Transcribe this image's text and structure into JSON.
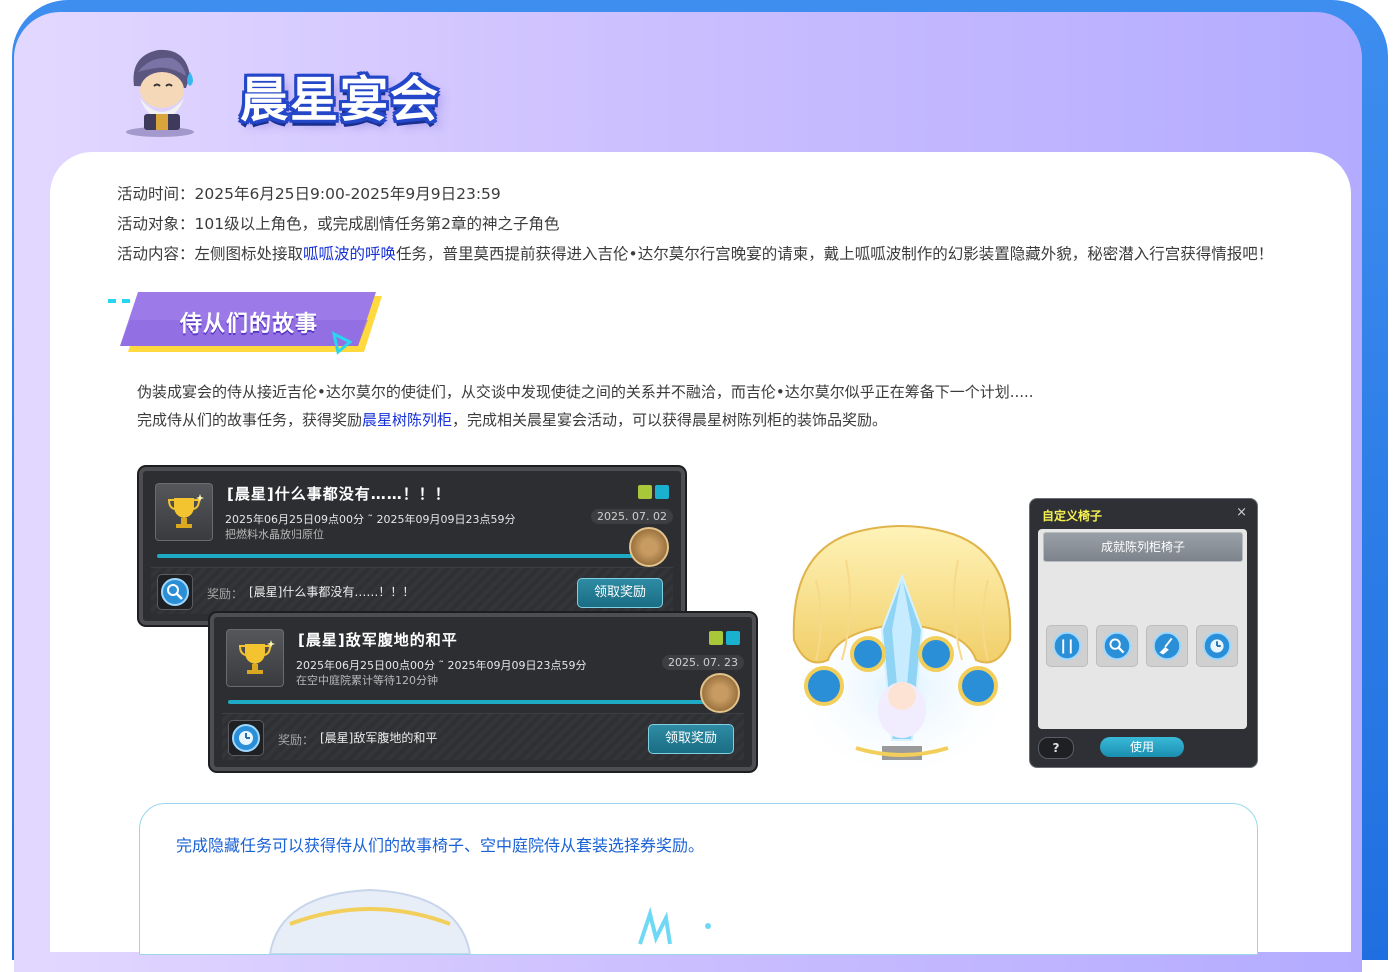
{
  "header": {
    "title": "晨星宴会"
  },
  "event_info": [
    {
      "label": "活动时间：",
      "value": "2025年6月25日9:00-2025年9月9日23:59"
    },
    {
      "label": "活动对象：",
      "value": "101级以上角色，或完成剧情任务第2章的神之子角色"
    },
    {
      "label": "活动内容：",
      "prefix": "左侧图标处接取",
      "highlight": "呱呱波的呼唤",
      "suffix": "任务，普里莫西提前获得进入吉伦•达尔莫尔行宫晚宴的请柬，戴上呱呱波制作的幻影装置隐藏外貌，秘密潜入行宫获得情报吧！"
    }
  ],
  "section": {
    "title": "侍从们的故事",
    "line1": "伪装成宴会的侍从接近吉伦•达尔莫尔的使徒们，从交谈中发现使徒之间的关系并不融洽，而吉伦•达尔莫尔似乎正在筹备下一个计划.....",
    "line2_prefix": "完成侍从们的故事任务，获得奖励",
    "line2_highlight": "晨星树陈列柜",
    "line2_suffix": "，完成相关晨星宴会活动，可以获得晨星树陈列柜的装饰品奖励。"
  },
  "quests": [
    {
      "title": "[晨星]什么事都没有……！！！",
      "date_range": "2025年06月25日09点00分 ˜ 2025年09月09日23点59分",
      "description": "把燃料水晶放归原位",
      "stamp": "2025. 07. 02",
      "reward_label": "奖励：",
      "reward_text": "[晨星]什么事都没有……！！！",
      "claim_label": "领取奖励"
    },
    {
      "title": "[晨星]敌军腹地的和平",
      "date_range": "2025年06月25日00点00分 ˜ 2025年09月09日23点59分",
      "description": "在空中庭院累计等待120分钟",
      "stamp": "2025. 07. 23",
      "reward_label": "奖励：",
      "reward_text": "[晨星]敌军腹地的和平",
      "claim_label": "领取奖励"
    }
  ],
  "chair_panel": {
    "title": "自定义椅子",
    "close_symbol": "×",
    "subtitle": "成就陈列柜椅子",
    "help_label": "?",
    "use_label": "使用",
    "slot_icons": [
      "cutlery-icon",
      "magnifier-icon",
      "broom-icon",
      "clock-icon"
    ]
  },
  "note": {
    "text": "完成隐藏任务可以获得侍从们的故事椅子、空中庭院侍从套装选择券奖励。"
  },
  "colors": {
    "frame_blue": "#1f6fe0",
    "link_blue": "#1530d8",
    "banner_purple": "#9c7ae8",
    "banner_yellow": "#ffd93d",
    "banner_cyan": "#28d6f0",
    "quest_bar": "#1ea9c4",
    "chair_title": "#f5f050",
    "note_blue": "#1a62d6"
  }
}
